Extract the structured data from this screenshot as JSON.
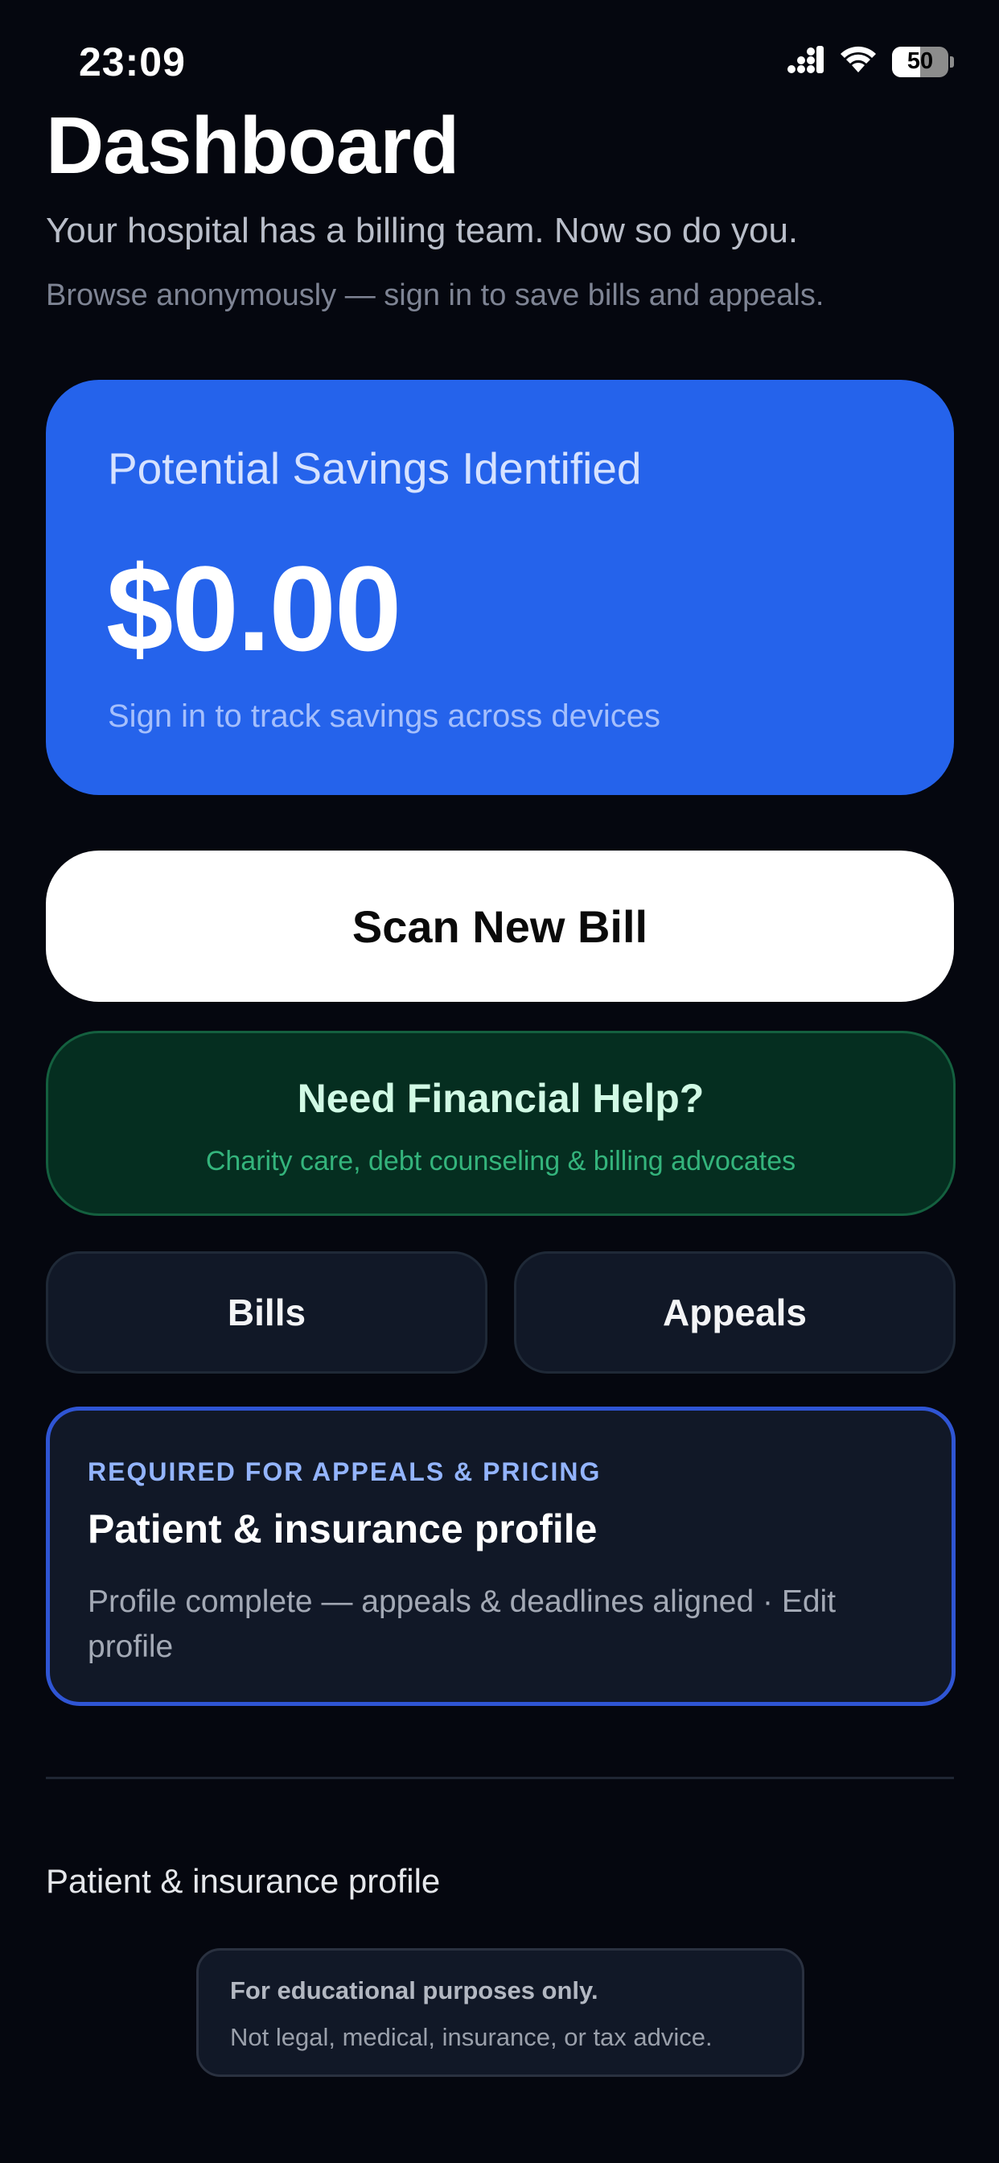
{
  "status_bar": {
    "time": "23:09",
    "battery_level": "50",
    "battery_fraction": 0.5,
    "icons": [
      "cellular-signal-icon",
      "wifi-icon",
      "battery-icon"
    ]
  },
  "header": {
    "title": "Dashboard",
    "subtitle": "Your hospital has a billing team. Now so do you.",
    "note": "Browse anonymously — sign in to save bills and appeals."
  },
  "savings_card": {
    "label": "Potential Savings Identified",
    "amount": "$0.00",
    "note": "Sign in to track savings across devices",
    "color": "#2563eb"
  },
  "scan_button": {
    "label": "Scan New Bill"
  },
  "help_card": {
    "title": "Need Financial Help?",
    "subtitle": "Charity care, debt counseling & billing advocates",
    "color": "#052e20"
  },
  "nav": {
    "bills_label": "Bills",
    "appeals_label": "Appeals"
  },
  "profile_card": {
    "kicker": "REQUIRED FOR APPEALS & PRICING",
    "title": "Patient & insurance profile",
    "description": "Profile complete — appeals & deadlines aligned · Edit profile",
    "accent": "#2f55d4"
  },
  "footer": {
    "profile_link": "Patient & insurance profile",
    "disclaimer_title": "For educational purposes only.",
    "disclaimer_body": "Not legal, medical, insurance, or tax advice."
  }
}
